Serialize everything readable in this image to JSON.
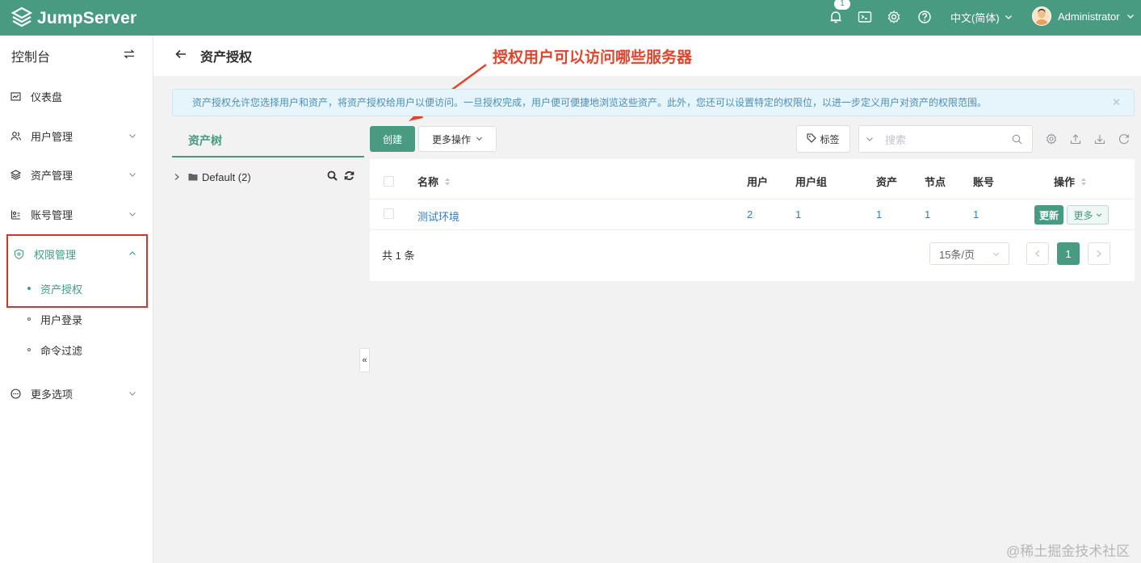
{
  "app": {
    "brand": "JumpServer",
    "accent": "#489a81",
    "notification_count": "1",
    "language": "中文(简体)",
    "user_name": "Administrator"
  },
  "sidebar": {
    "title": "控制台",
    "items": [
      {
        "label": "仪表盘",
        "icon": "dashboard-icon"
      },
      {
        "label": "用户管理",
        "icon": "users-icon"
      },
      {
        "label": "资产管理",
        "icon": "assets-icon"
      },
      {
        "label": "账号管理",
        "icon": "accounts-icon"
      },
      {
        "label": "权限管理",
        "icon": "shield-icon"
      },
      {
        "label": "更多选项",
        "icon": "more-icon"
      }
    ],
    "sub_items": [
      {
        "label": "资产授权",
        "active": true
      },
      {
        "label": "用户登录",
        "active": false
      },
      {
        "label": "命令过滤",
        "active": false
      }
    ]
  },
  "page": {
    "title": "资产授权"
  },
  "annotation": {
    "text": "授权用户可以访问哪些服务器",
    "color": "#e0452e"
  },
  "notice": {
    "text": "资产授权允许您选择用户和资产，将资产授权给用户以便访问。一旦授权完成，用户便可便捷地浏览这些资产。此外，您还可以设置特定的权限位，以进一步定义用户对资产的权限范围。"
  },
  "tree": {
    "tab": "资产树",
    "root_label": "Default (2)"
  },
  "toolbar": {
    "create": "创建",
    "more_actions": "更多操作",
    "tags": "标签",
    "search_placeholder": "搜索"
  },
  "table": {
    "headers": {
      "name": "名称",
      "users": "用户",
      "user_groups": "用户组",
      "assets": "资产",
      "nodes": "节点",
      "accounts": "账号",
      "actions": "操作"
    },
    "rows": [
      {
        "name": "测试环境",
        "users": "2",
        "user_groups": "1",
        "assets": "1",
        "nodes": "1",
        "accounts": "1",
        "update": "更新",
        "more": "更多"
      }
    ],
    "total": "共 1 条",
    "page_size": "15条/页",
    "current_page": "1"
  },
  "watermark": "@稀土掘金技术社区"
}
